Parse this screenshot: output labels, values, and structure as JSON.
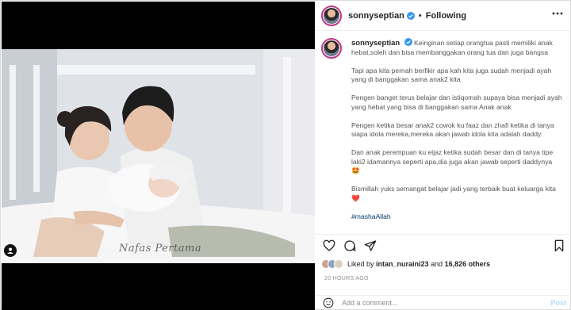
{
  "post": {
    "username": "sonnyseptian",
    "follow_status": "Following",
    "separator": "•",
    "watermark": "Nafas Pertama",
    "caption_username": "sonnyseptian",
    "caption": [
      "Keinginan setiap orangtua pasti memiliki anak hebat,soleh dan bisa membanggakan orang tua dan juga bangsa",
      "Tapi apa kita pernah berfikir apa kah kita juga sudah menjadi ayah yang di banggakan sama anak2 kita",
      "Pengen banget terus belajar dan istiqomah supaya bisa menjadi ayah yang hebat yang bisa di banggakan sama Anak anak",
      "Pengen ketika besar anak2 cowok ku faaz dan zhafi ketika di tanya siapa idola mereka,mereka akan jawab idola kita adalah daddy.",
      "Dan anak perempuan ku eijaz ketika sudah besar dan di tanya tipe laki2 idamannya seperti apa,dia juga akan jawab seperti daddynya 🤩",
      "Bismillah yuks semangat belajar jadi yang terbaik buat keluarga kita ❤️"
    ],
    "hashtag": "#mashaAllah",
    "likes": {
      "prefix": "Liked by",
      "user": "intan_nuraini23",
      "connector": "and",
      "others": "16,826 others"
    },
    "time": "20 HOURS AGO",
    "comment": {
      "placeholder": "Add a comment...",
      "post_label": "Post"
    }
  },
  "icons": {
    "verified": "verified-badge-icon",
    "more": "more-options-icon",
    "like": "heart-icon",
    "comment": "comment-icon",
    "share": "share-icon",
    "save": "bookmark-icon",
    "emoji": "emoji-icon",
    "tag": "user-tag-icon"
  },
  "colors": {
    "accent_ring": "#c13584",
    "link": "#00376b",
    "verified": "#3897f0",
    "post_disabled": "#b2dffc"
  }
}
